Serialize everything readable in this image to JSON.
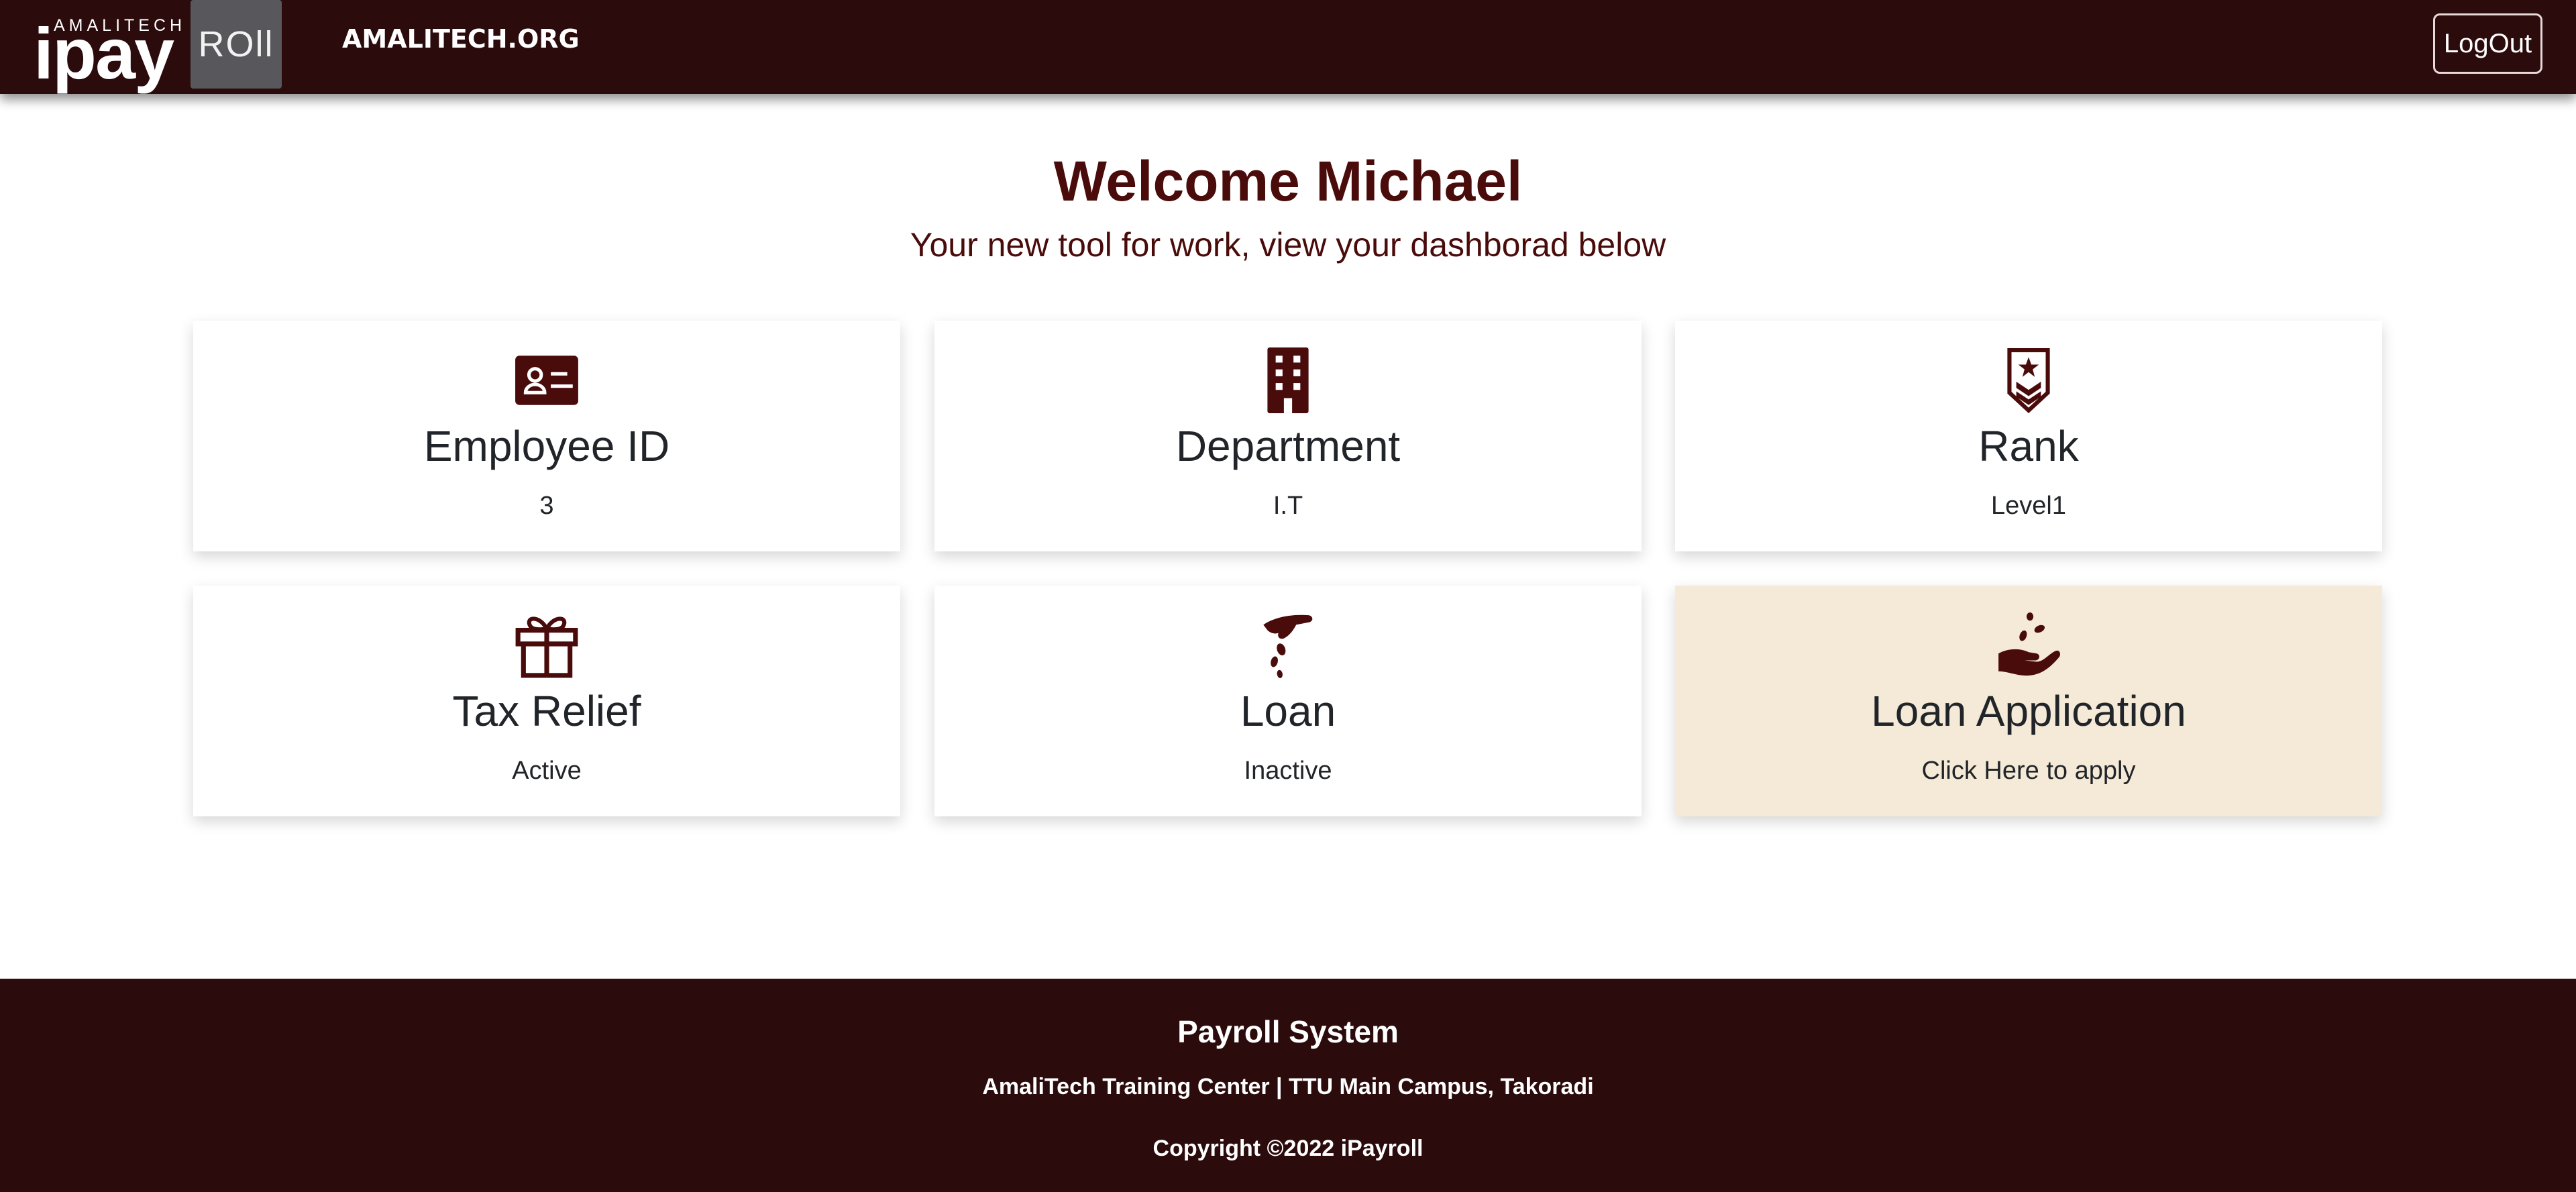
{
  "header": {
    "logo_small": "AMALITECH",
    "logo_main": "ipay",
    "logo_box": "ROll",
    "brand": "AMALITECH.ORG",
    "logout_label": "LogOut"
  },
  "welcome": {
    "title": "Welcome Michael",
    "subtitle": "Your new tool for work, view your dashborad below"
  },
  "cards": [
    {
      "title": "Employee ID",
      "value": "3",
      "icon": "id-card-icon"
    },
    {
      "title": "Department",
      "value": "I.T",
      "icon": "building-icon"
    },
    {
      "title": "Rank",
      "value": "Level1",
      "icon": "rank-badge-icon"
    },
    {
      "title": "Tax Relief",
      "value": "Active",
      "icon": "gift-icon"
    },
    {
      "title": "Loan",
      "value": "Inactive",
      "icon": "hand-coins-icon"
    },
    {
      "title": "Loan Application",
      "value": "Click Here to apply",
      "icon": "seedling-hand-icon"
    }
  ],
  "footer": {
    "title": "Payroll System",
    "address": "AmaliTech Training Center | TTU Main Campus, Takoradi",
    "copyright": "Copyright ©2022 iPayroll"
  },
  "colors": {
    "header_bg": "#2c0b0c",
    "accent": "#4a0b0b",
    "highlight_card": "#f5ead8"
  }
}
